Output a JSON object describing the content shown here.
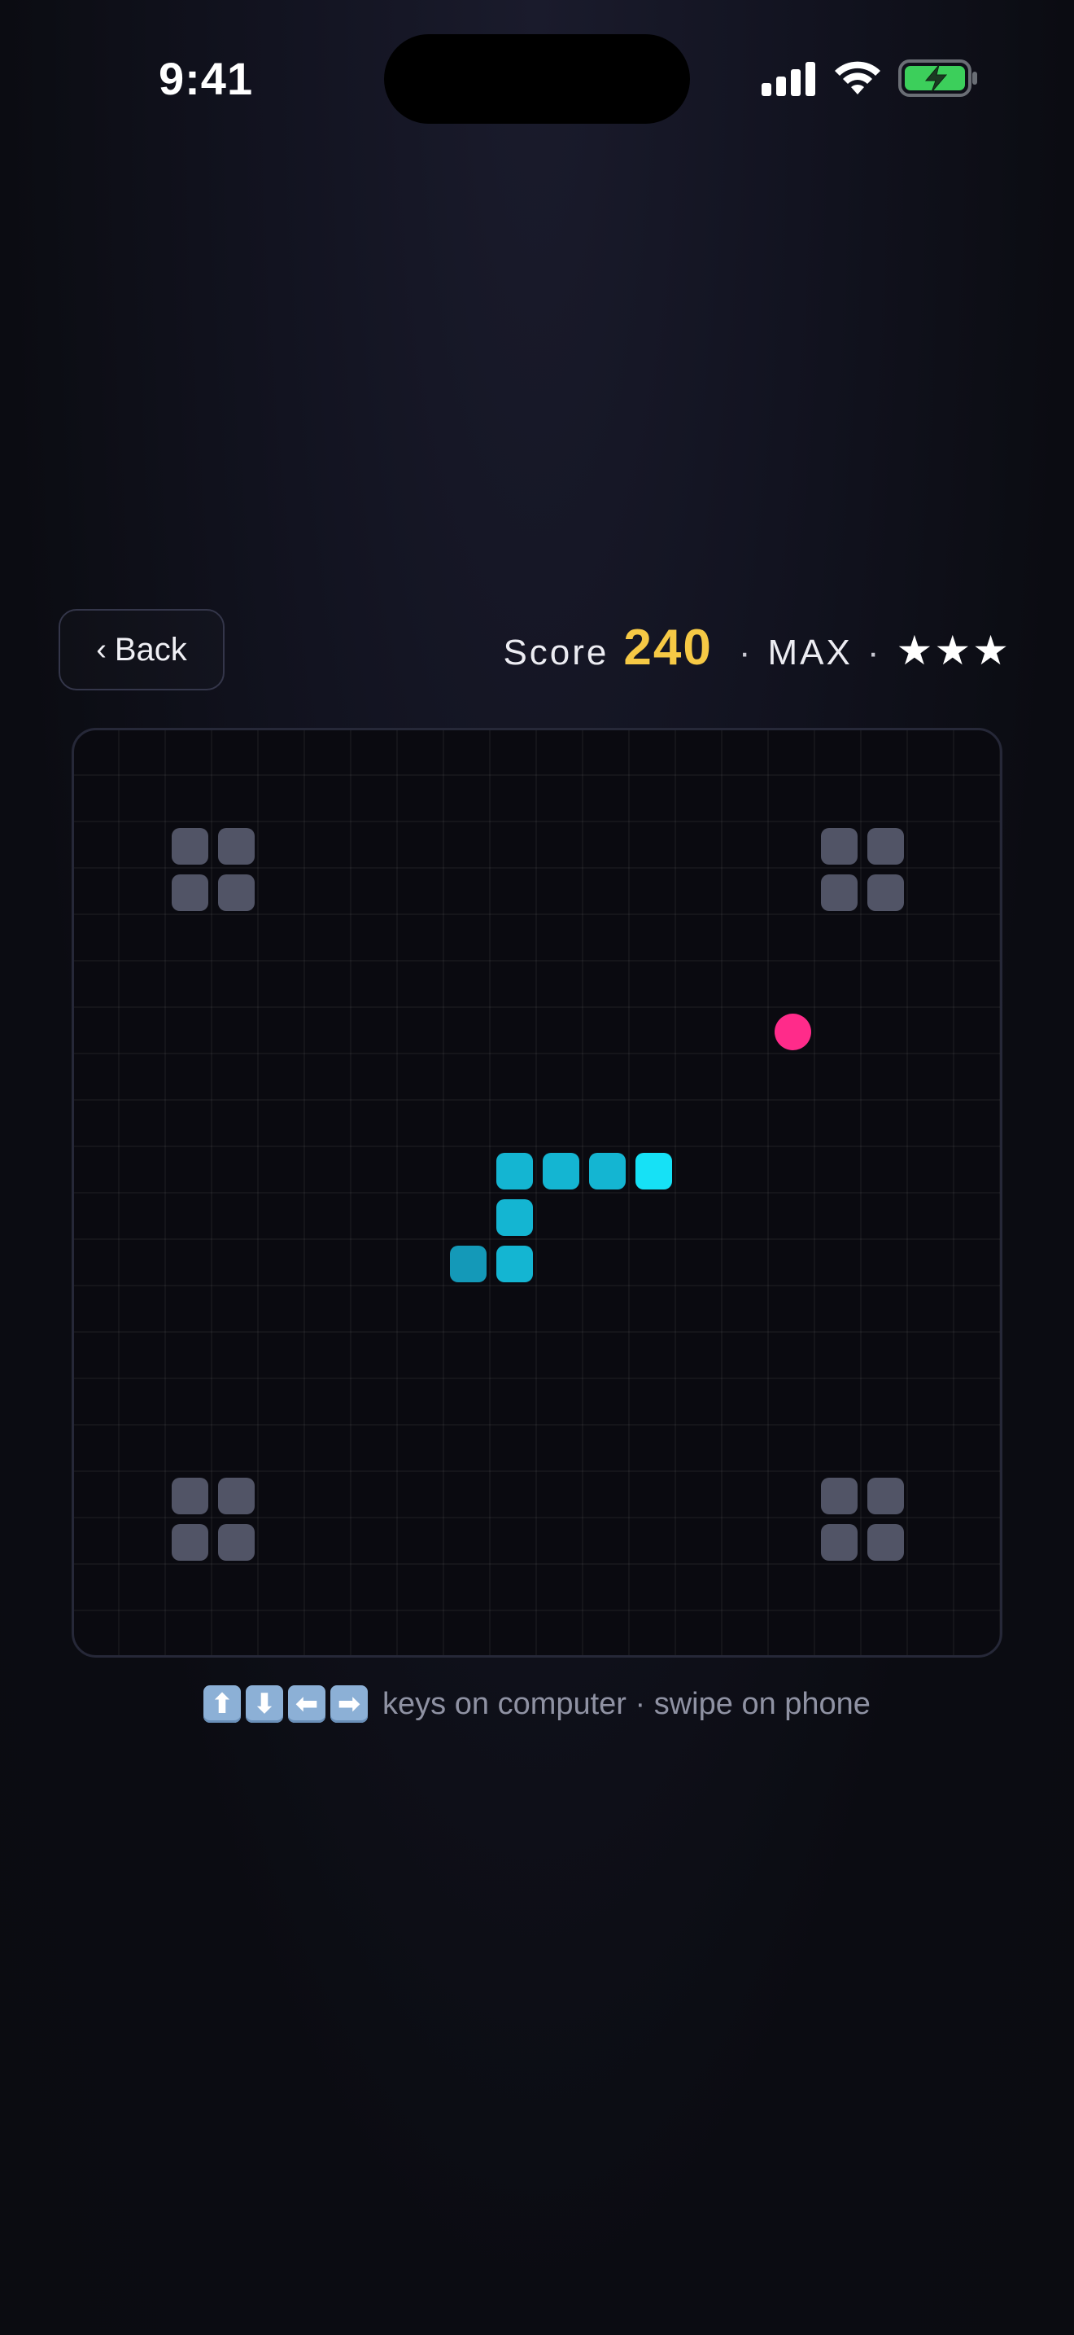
{
  "status_bar": {
    "time": "9:41"
  },
  "header": {
    "back_chevron": "‹",
    "back_label": "Back",
    "score_label": "Score",
    "score_value": "240",
    "separator": "·",
    "level": "MAX",
    "stars": "★★★",
    "stars_count": 3
  },
  "board": {
    "grid_cols": 20,
    "grid_rows": 20,
    "walls": [
      [
        2,
        2
      ],
      [
        3,
        2
      ],
      [
        2,
        3
      ],
      [
        3,
        3
      ],
      [
        16,
        2
      ],
      [
        17,
        2
      ],
      [
        16,
        3
      ],
      [
        17,
        3
      ],
      [
        2,
        16
      ],
      [
        3,
        16
      ],
      [
        2,
        17
      ],
      [
        3,
        17
      ],
      [
        16,
        16
      ],
      [
        17,
        16
      ],
      [
        16,
        17
      ],
      [
        17,
        17
      ]
    ],
    "snake": [
      [
        12,
        9
      ],
      [
        11,
        9
      ],
      [
        10,
        9
      ],
      [
        9,
        9
      ],
      [
        9,
        10
      ],
      [
        9,
        11
      ],
      [
        8,
        11
      ]
    ],
    "food": [
      15,
      6
    ],
    "colors": {
      "snake": "#14b5d2",
      "snake_head": "#16e1f6",
      "food": "#ff2b8a",
      "wall": "#515466"
    }
  },
  "hint": {
    "keys": [
      "⬆",
      "⬇",
      "⬅",
      "➡"
    ],
    "text": "keys on computer · swipe on phone"
  }
}
